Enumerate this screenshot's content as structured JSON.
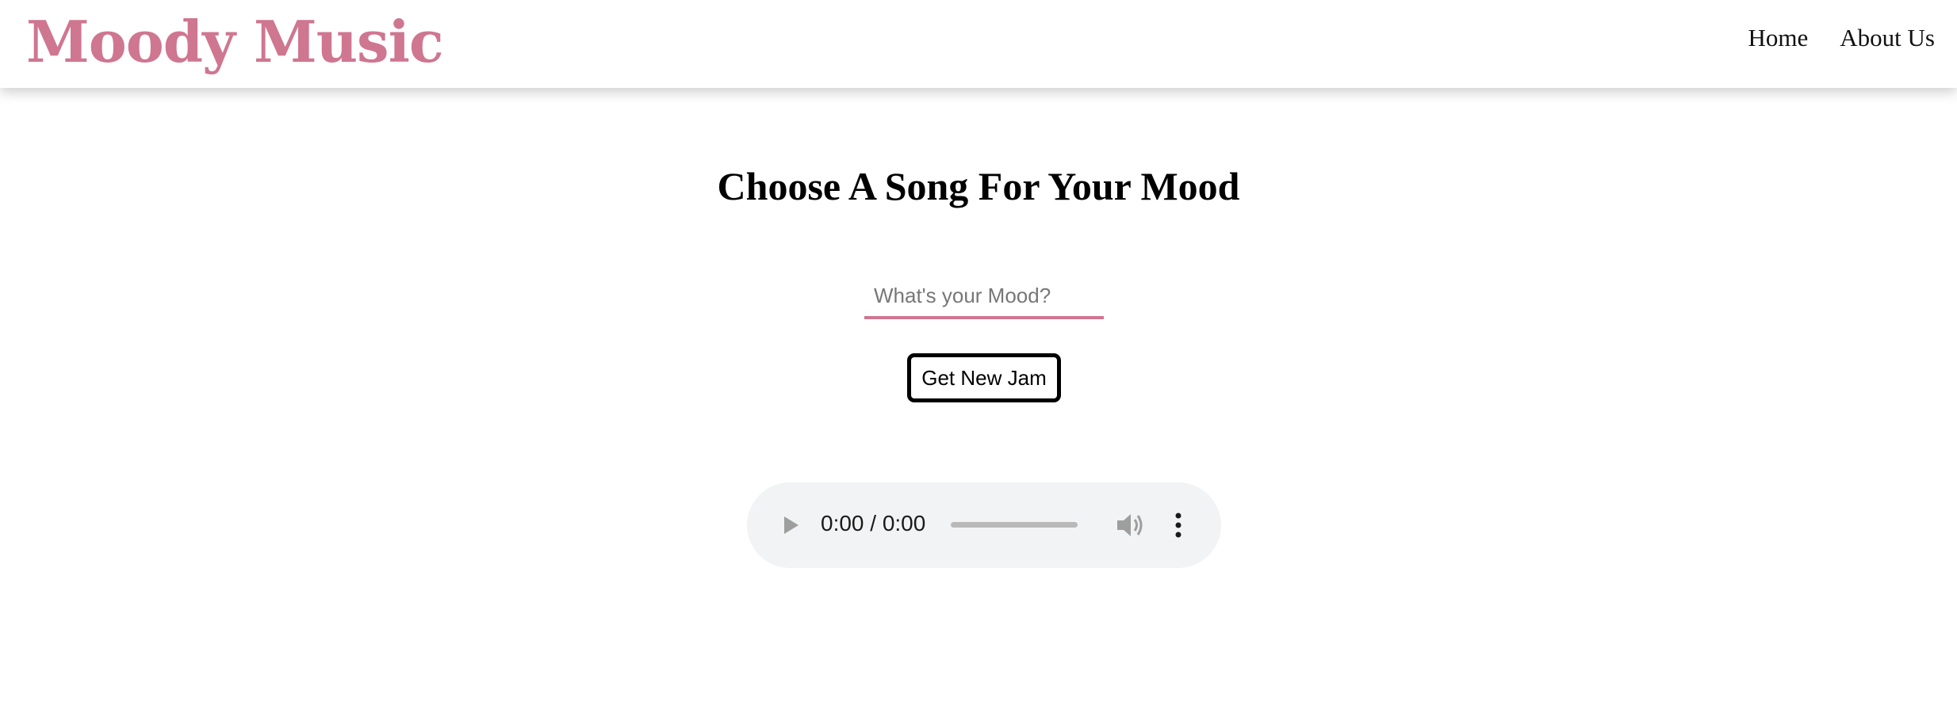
{
  "header": {
    "brand": "Moody Music",
    "nav": [
      {
        "label": "Home"
      },
      {
        "label": "About Us"
      }
    ]
  },
  "main": {
    "title": "Choose A Song For Your Mood",
    "mood_input": {
      "value": "",
      "placeholder": "What's your Mood?"
    },
    "button_label": "Get New Jam",
    "audio": {
      "time": "0:00 / 0:00",
      "progress": 0,
      "icons": [
        "play-icon",
        "volume-icon",
        "more-vertical-icon"
      ]
    }
  },
  "colors": {
    "brand": "#cf7691",
    "audio_bg": "#f1f3f4",
    "control_gray": "#9e9e9e"
  }
}
